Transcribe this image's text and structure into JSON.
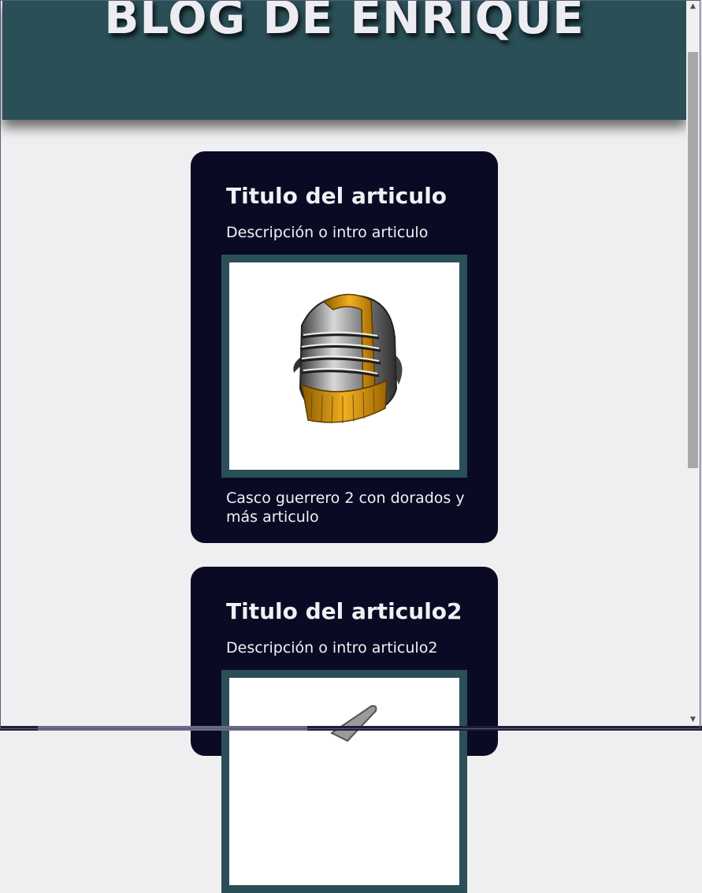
{
  "header": {
    "title": "BLOG DE ENRIQUE"
  },
  "articles": [
    {
      "title": "Titulo del articulo",
      "description": "Descripción o intro articulo",
      "image_icon": "knight-helmet-icon",
      "caption": "Casco guerrero 2 con dorados y más articulo"
    },
    {
      "title": "Titulo del articulo2",
      "description": "Descripción o intro articulo2",
      "image_icon": "sword-icon"
    }
  ],
  "colors": {
    "header_bg": "#2a4f57",
    "card_bg": "#0b0a24",
    "page_bg": "#efeff1",
    "text_light": "#f1f1f5"
  }
}
